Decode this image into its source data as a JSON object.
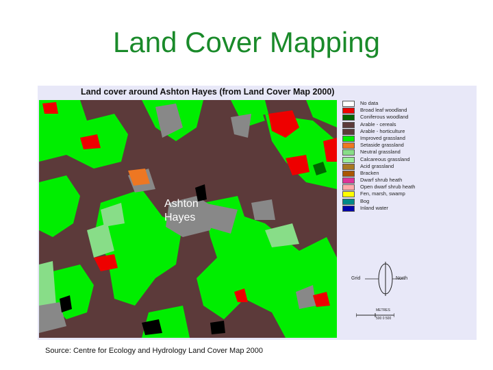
{
  "slide": {
    "title": "Land Cover Mapping"
  },
  "map": {
    "title": "Land cover around Ashton Hayes (from Land Cover Map 2000)",
    "place_label_line1": "Ashton",
    "place_label_line2": "Hayes",
    "compass": {
      "left_label": "Grid",
      "right_label": "North"
    },
    "scale": {
      "top_label": "METRES",
      "bottom_label": "500 0 500"
    },
    "colors": {
      "arable": "#5c3a3a",
      "improved_grassland": "#00ee00",
      "neutral_grassland": "#88dd88",
      "urban": "#888888",
      "broadleaf": "#ee0000",
      "coniferous": "#006600",
      "setaside": "#ee7722",
      "suburban": "#000000"
    }
  },
  "legend": [
    {
      "label": "No data",
      "color": "#ffffff"
    },
    {
      "label": "Broad leaf woodland",
      "color": "#ee0000"
    },
    {
      "label": "Coniferous woodland",
      "color": "#006600"
    },
    {
      "label": "Arable - cereals",
      "color": "#5c3a3a"
    },
    {
      "label": "Arable - horticulture",
      "color": "#5c3a3a"
    },
    {
      "label": "Improved grassland",
      "color": "#00ee00"
    },
    {
      "label": "Setaside grassland",
      "color": "#ee7722"
    },
    {
      "label": "Neutral grassland",
      "color": "#88dd88"
    },
    {
      "label": "Calcareous grassland",
      "color": "#99ee99"
    },
    {
      "label": "Acid grassland",
      "color": "#aa7722"
    },
    {
      "label": "Bracken",
      "color": "#aa5500"
    },
    {
      "label": "Dwarf shrub heath",
      "color": "#dd3399"
    },
    {
      "label": "Open dwarf shrub heath",
      "color": "#ffaaaa"
    },
    {
      "label": "Fen, marsh, swamp",
      "color": "#ffff00"
    },
    {
      "label": "Bog",
      "color": "#008888"
    },
    {
      "label": "Inland water",
      "color": "#0000aa"
    }
  ],
  "source": "Source: Centre for Ecology and Hydrology Land Cover Map 2000"
}
